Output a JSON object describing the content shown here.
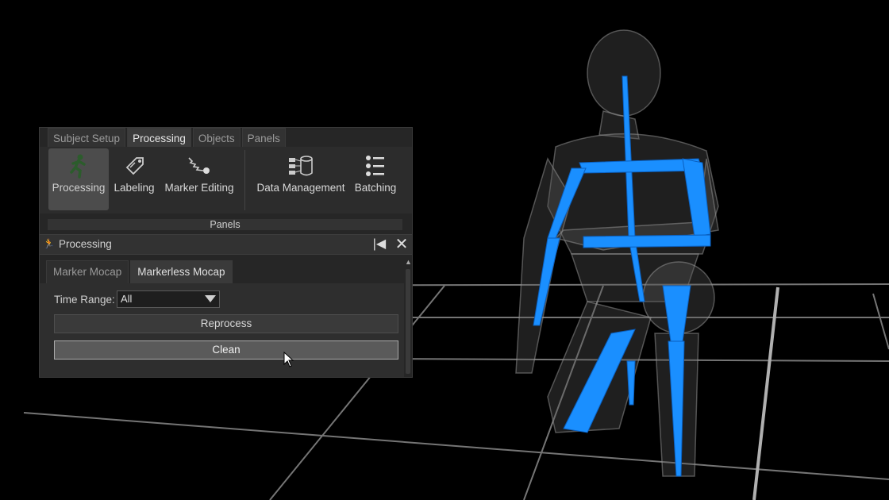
{
  "ribbon_tabs": [
    "Subject Setup",
    "Processing",
    "Objects",
    "Panels"
  ],
  "ribbon_buttons": {
    "processing": "Processing",
    "labeling": "Labeling",
    "marker_editing": "Marker Editing",
    "data_management": "Data Management",
    "batching": "Batching"
  },
  "panels_bar_label": "Panels",
  "processing_panel": {
    "title": "Processing",
    "subtabs": [
      "Marker Mocap",
      "Markerless Mocap"
    ],
    "time_range_label": "Time Range:",
    "time_range_value": "All",
    "reprocess_label": "Reprocess",
    "clean_label": "Clean"
  },
  "colors": {
    "bone": "#1a8fff",
    "grid": "#bfbfbf",
    "panel_bg": "#262626"
  }
}
